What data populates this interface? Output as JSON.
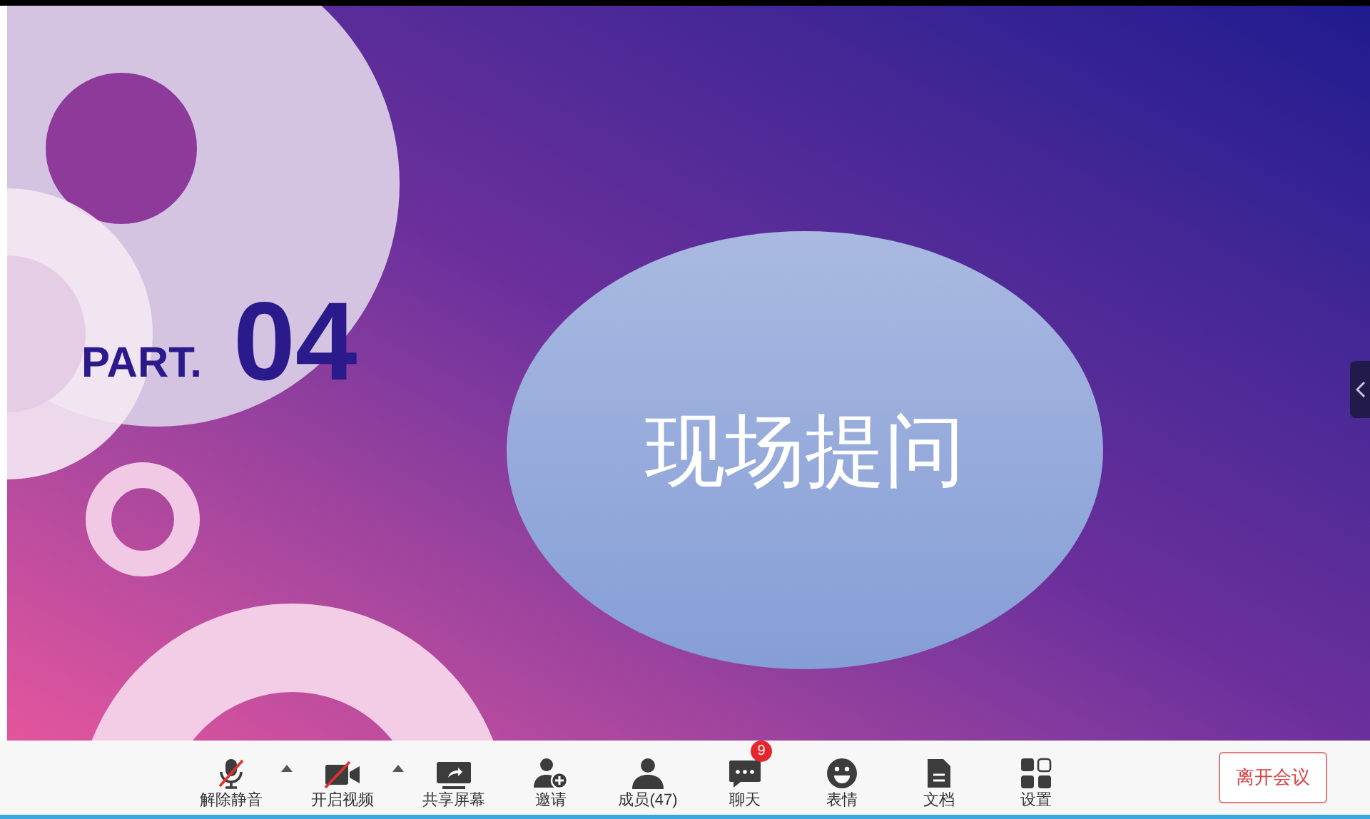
{
  "slide": {
    "part_label": "PART.",
    "number": "04",
    "title": "现场提问"
  },
  "side_panel_toggle": {
    "expanded": false
  },
  "toolbar": {
    "items": [
      {
        "kind": "mic",
        "label": "解除静音",
        "off": true,
        "has_menu": true
      },
      {
        "kind": "video",
        "label": "开启视频",
        "off": true,
        "has_menu": true
      },
      {
        "kind": "share",
        "label": "共享屏幕"
      },
      {
        "kind": "invite",
        "label": "邀请"
      },
      {
        "kind": "members",
        "label": "成员(47)"
      },
      {
        "kind": "chat",
        "label": "聊天",
        "badge": "9"
      },
      {
        "kind": "emoji",
        "label": "表情"
      },
      {
        "kind": "docs",
        "label": "文档"
      },
      {
        "kind": "settings",
        "label": "设置"
      }
    ],
    "leave_button": "离开会议"
  }
}
